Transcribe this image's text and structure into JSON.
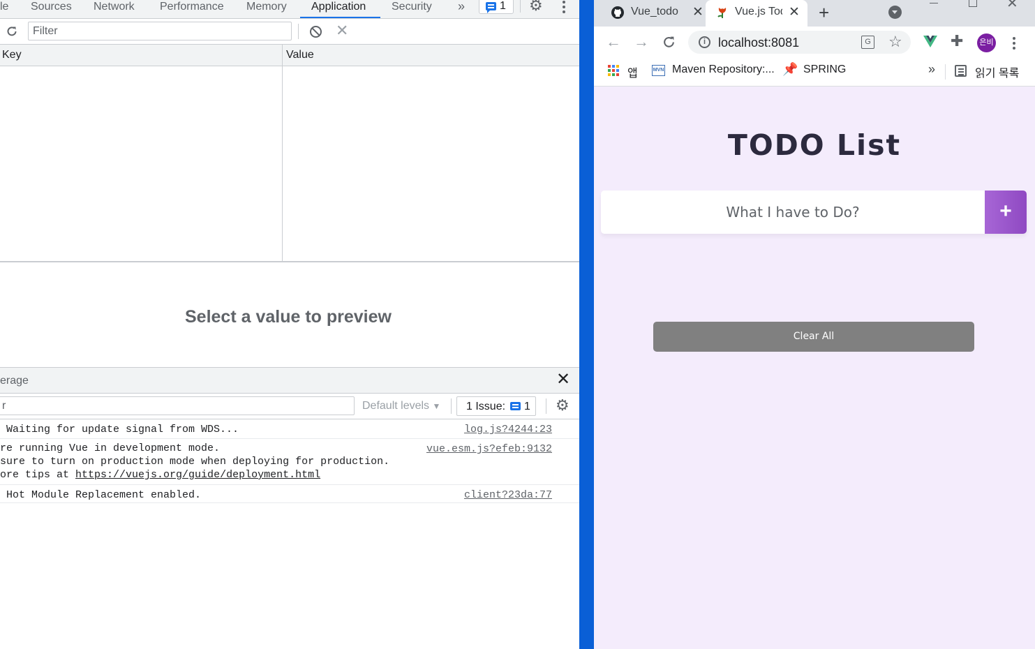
{
  "devtools": {
    "tabs": [
      "le",
      "Sources",
      "Network",
      "Performance",
      "Memory",
      "Application",
      "Security"
    ],
    "issue_count": "1",
    "filter_placeholder": "Filter",
    "table": {
      "key_header": "Key",
      "value_header": "Value"
    },
    "preview_message": "Select a value to preview",
    "drawer_title": "erage",
    "console_filter_value": "r",
    "default_levels": "Default levels",
    "issues_label": "1 Issue:",
    "issues_count": "1",
    "messages": [
      {
        "lines": [
          " Waiting for update signal from WDS..."
        ],
        "source": "log.js?4244:23"
      },
      {
        "lines": [
          "re running Vue in development mode.",
          "sure to turn on production mode when deploying for production.",
          "ore tips at "
        ],
        "link": "https://vuejs.org/guide/deployment.html",
        "source": "vue.esm.js?efeb:9132"
      },
      {
        "lines": [
          " Hot Module Replacement enabled."
        ],
        "source": "client?23da:77"
      }
    ]
  },
  "browser": {
    "tabs": [
      {
        "title": "Vue_todo",
        "icon": "github-icon"
      },
      {
        "title": "Vue.js Todo",
        "icon": "flower-icon"
      }
    ],
    "url": "localhost:8081",
    "profile_initials": "은비",
    "bookmarks": [
      "앱",
      "Maven Repository:...",
      "SPRING"
    ],
    "reading_list": "읽기 목록",
    "more_bookmarks": "»"
  },
  "page": {
    "title": "TODO List",
    "input_placeholder": "What I have to Do?",
    "add_button": "+",
    "clear_all": "Clear All"
  },
  "colors": {
    "accent": "#1a73e8",
    "desktop": "#0a5fd6",
    "page_bg": "#f4ecfc",
    "add_button": "#9b58cc",
    "clear_button": "#808080"
  }
}
